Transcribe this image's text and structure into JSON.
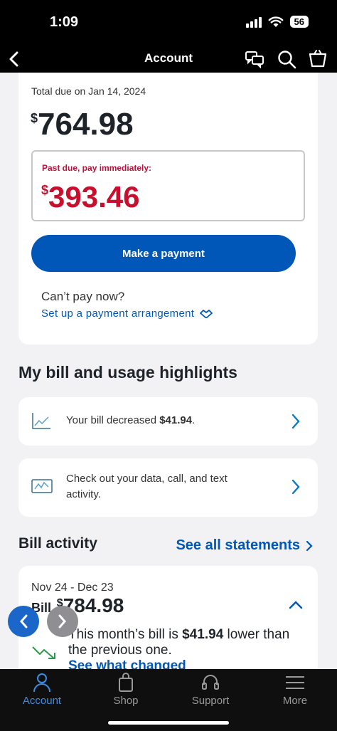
{
  "status": {
    "time": "1:09",
    "battery": "56"
  },
  "nav": {
    "title": "Account",
    "icons": [
      "back-chevron-icon",
      "chat-icon",
      "search-icon",
      "cart-icon"
    ]
  },
  "total": {
    "label": "Total due on Jan 14, 2024",
    "currency": "$",
    "amount": "764.98"
  },
  "past_due": {
    "label": "Past due, pay immediately:",
    "currency": "$",
    "amount": "393.46"
  },
  "payment_button": "Make a payment",
  "cant_pay": {
    "question": "Can’t pay now?",
    "link": "Set up a payment arrangement"
  },
  "highlights": {
    "title": "My bill and usage highlights",
    "items": [
      {
        "prefix": "Your bill decreased ",
        "amount": "$41.94",
        "suffix": ".",
        "icon": "trend-chart-icon"
      },
      {
        "text": "Check out your data, call, and text activity.",
        "icon": "activity-monitor-icon"
      }
    ]
  },
  "bill_activity": {
    "title": "Bill activity",
    "see_all": "See all statements",
    "period": "Nov 24 - Dec 23",
    "bill_label": "Bill",
    "currency": "$",
    "bill_amount": "784.98",
    "desc_prefix": "This month’s bill is ",
    "desc_amount": "$41.94",
    "desc_suffix": " lower than the previous one.",
    "link": "See what changed"
  },
  "tabs": [
    {
      "label": "Account",
      "icon": "person-icon",
      "active": true
    },
    {
      "label": "Shop",
      "icon": "shopping-bag-icon",
      "active": false
    },
    {
      "label": "Support",
      "icon": "headset-icon",
      "active": false
    },
    {
      "label": "More",
      "icon": "menu-icon",
      "active": false
    }
  ],
  "colors": {
    "accent": "#0057b8",
    "past_due": "#c8102e",
    "tab_active": "#3a8ee6"
  }
}
